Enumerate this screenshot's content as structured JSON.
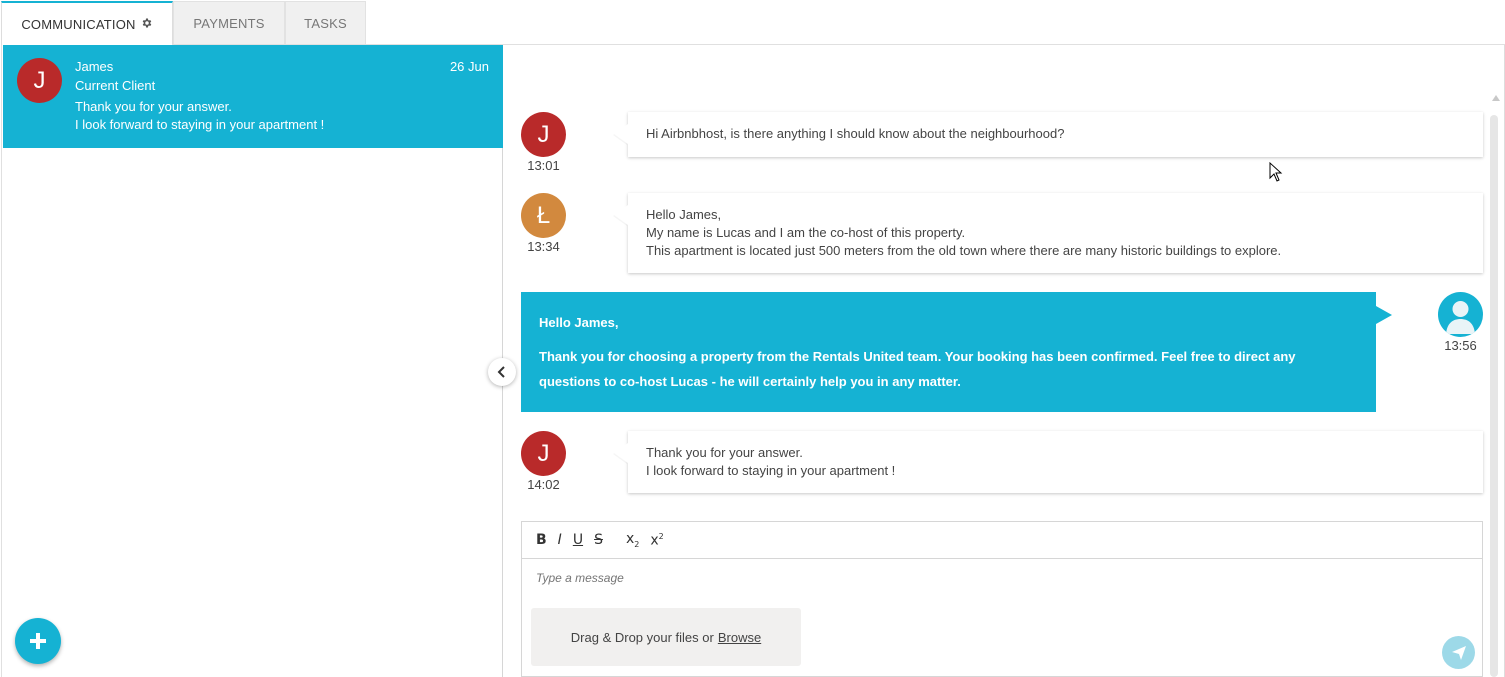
{
  "tabs": [
    {
      "label": "COMMUNICATION",
      "active": true,
      "icon": "gear-icon"
    },
    {
      "label": "PAYMENTS",
      "active": false
    },
    {
      "label": "TASKS",
      "active": false
    }
  ],
  "conversation": {
    "initial": "J",
    "name": "James",
    "date": "26 Jun",
    "role": "Current Client",
    "preview_line1": "Thank you for your answer.",
    "preview_line2": "I look forward to staying in your apartment !"
  },
  "messages": [
    {
      "initial": "J",
      "time": "13:01",
      "lines": [
        "Hi Airbnbhost, is there anything I should know about the neighbourhood?"
      ]
    },
    {
      "initial": "Ł",
      "time": "13:34",
      "lines": [
        "Hello James,",
        "My name is Lucas and I am the co-host of this property.",
        "This apartment is located just 500 meters from the old town where there are many historic buildings to explore."
      ]
    },
    {
      "time": "13:56",
      "outgoing": true,
      "paragraphs": [
        "Hello James,",
        "Thank you for choosing a property from the Rentals United team. Your booking has been confirmed. Feel free to direct any questions to co-host Lucas - he will certainly help you in any matter."
      ]
    },
    {
      "initial": "J",
      "time": "14:02",
      "lines": [
        "Thank you for your answer.",
        "I look forward to staying in your apartment !"
      ]
    }
  ],
  "editor": {
    "toolbar": {
      "bold": "B",
      "italic": "I",
      "underline": "U",
      "strike": "S",
      "subscript": "x",
      "superscript": "x"
    },
    "placeholder": "Type a message",
    "dropzone_text": "Drag & Drop your files or",
    "browse_label": "Browse"
  },
  "colors": {
    "accent": "#15b2d3",
    "avatar_red": "#b92a2a",
    "avatar_orange": "#d2893e"
  }
}
